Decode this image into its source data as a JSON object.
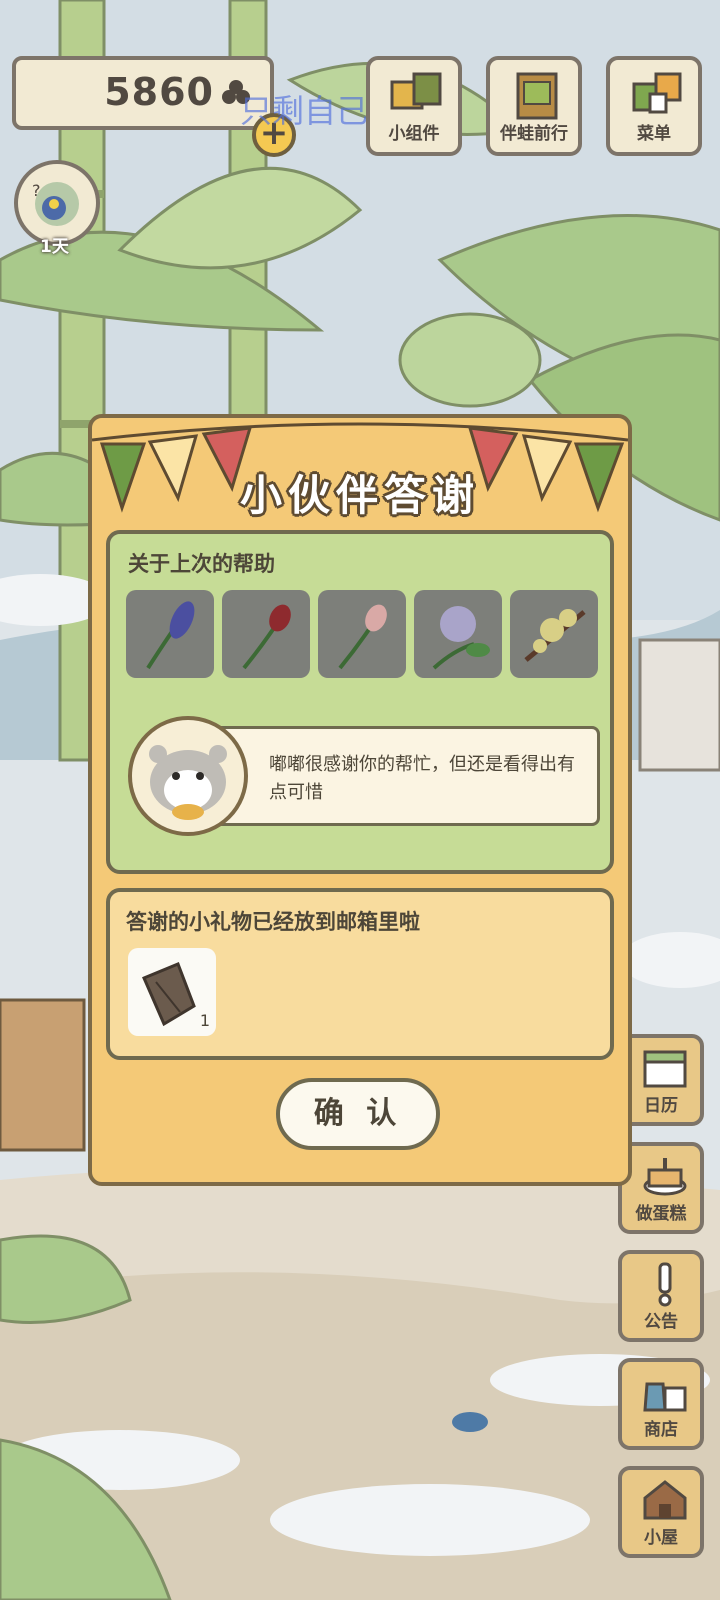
{
  "hud": {
    "clover_count": "5860",
    "watermark": "只剩自己就好",
    "day_label": "1天",
    "top_buttons": [
      {
        "label": "小组件",
        "icon": "widget-icon"
      },
      {
        "label": "伴蛙前行",
        "icon": "frog-book-icon"
      },
      {
        "label": "菜单",
        "icon": "menu-cards-icon"
      }
    ],
    "side_buttons": [
      {
        "label": "日历",
        "icon": "calendar-icon"
      },
      {
        "label": "做蛋糕",
        "icon": "cake-icon"
      },
      {
        "label": "公告",
        "icon": "exclamation-icon"
      },
      {
        "label": "商店",
        "icon": "shop-bags-icon"
      },
      {
        "label": "小屋",
        "icon": "house-icon"
      }
    ]
  },
  "dialog": {
    "title": "小伙伴答谢",
    "help_section_title": "关于上次的帮助",
    "flowers": [
      {
        "icon": "hyacinth-icon",
        "color": "#4b4fa0"
      },
      {
        "icon": "red-tulip-icon",
        "color": "#8e2a2e"
      },
      {
        "icon": "pink-tulip-icon",
        "color": "#d9a9a6"
      },
      {
        "icon": "lilac-icon",
        "color": "#a9a4c9"
      },
      {
        "icon": "yellow-blossom-icon",
        "color": "#d8cf86"
      }
    ],
    "speech": "嘟嘟很感谢你的帮忙，但还是看得出有点可惜",
    "gift_section_title": "答谢的小礼物已经放到邮箱里啦",
    "gift_item": {
      "icon": "wood-bark-icon",
      "count": "1"
    },
    "confirm_label": "确 认"
  },
  "colors": {
    "dialog_bg": "#f4c977",
    "help_panel_bg": "#c6dc96",
    "gift_panel_bg": "#f8dc9e",
    "outline": "#7d6a47"
  }
}
